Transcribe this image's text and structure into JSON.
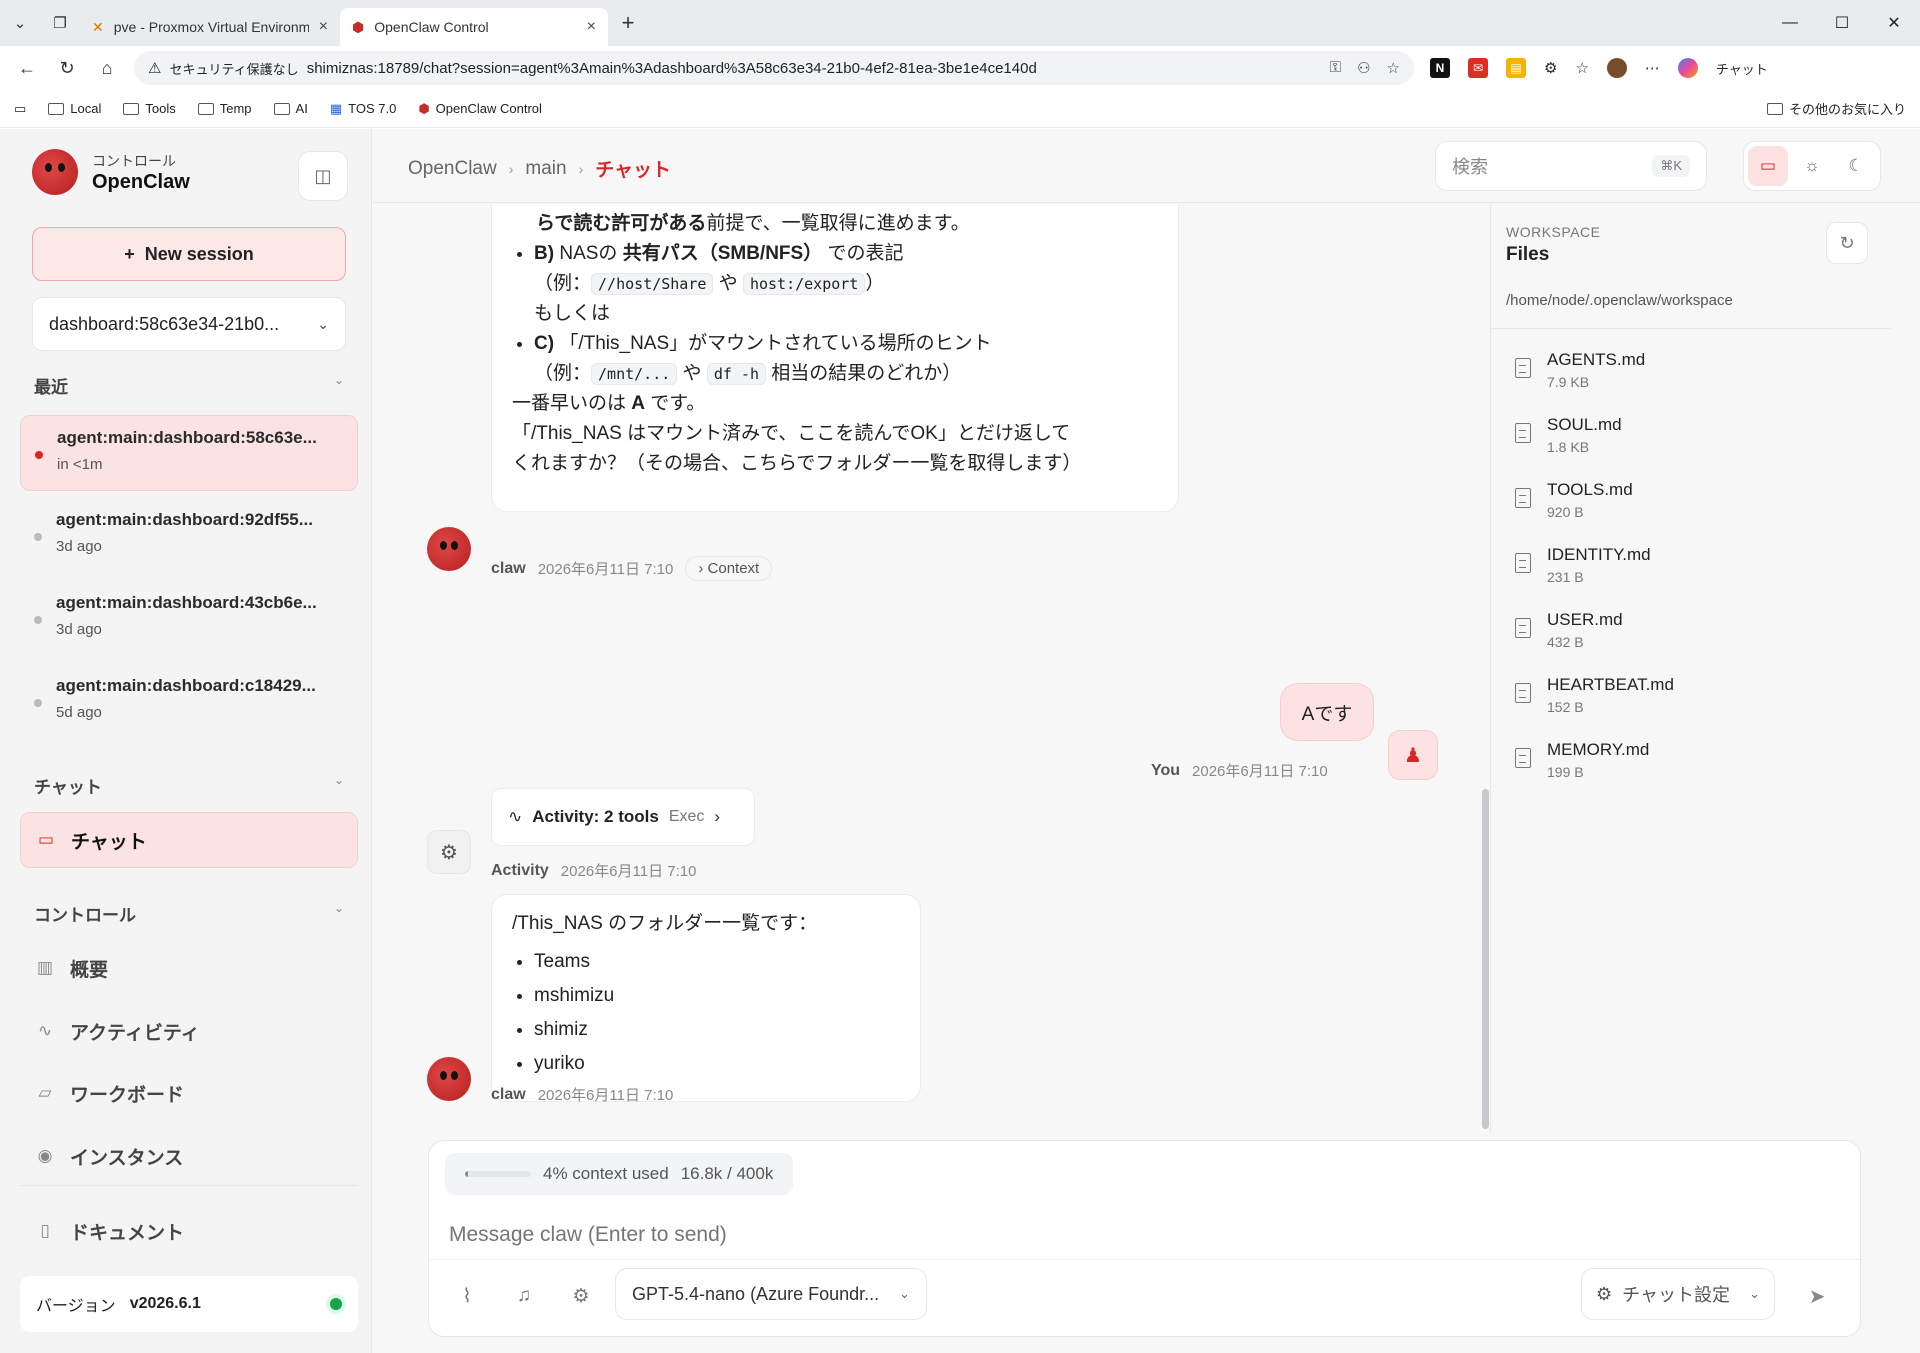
{
  "browser": {
    "tabs": [
      {
        "title": "pve - Proxmox Virtual Environment",
        "active": false
      },
      {
        "title": "OpenClaw Control",
        "active": true
      }
    ],
    "address": {
      "warning": "セキュリティ保護なし",
      "url": "shimiznas:18789/chat?session=agent%3Amain%3Adashboard%3A58c63e34-21b0-4ef2-81ea-3be1e4ce140d"
    },
    "copilot_label": "チャット",
    "bookmarks": [
      "Local",
      "Tools",
      "Temp",
      "AI",
      "TOS 7.0",
      "OpenClaw Control"
    ],
    "bookmarks_other": "その他のお気に入り"
  },
  "sidebar": {
    "brand_sub": "コントロール",
    "brand_title": "OpenClaw",
    "new_session": "New session",
    "session_select": "dashboard:58c63e34-21b0...",
    "recent_header": "最近",
    "sessions": [
      {
        "name": "agent:main:dashboard:58c63e...",
        "time": "in <1m"
      },
      {
        "name": "agent:main:dashboard:92df55...",
        "time": "3d ago"
      },
      {
        "name": "agent:main:dashboard:43cb6e...",
        "time": "3d ago"
      },
      {
        "name": "agent:main:dashboard:c18429...",
        "time": "5d ago"
      }
    ],
    "chat_header": "チャット",
    "chat_item": "チャット",
    "control_header": "コントロール",
    "control_items": [
      "概要",
      "アクティビティ",
      "ワークボード",
      "インスタンス"
    ],
    "docs": "ドキュメント",
    "version_label": "バージョン",
    "version_value": "v2026.6.1"
  },
  "header": {
    "crumbs": [
      "OpenClaw",
      "main",
      "チャット"
    ],
    "search_placeholder": "検索",
    "search_kbd": "⌘K"
  },
  "chat": {
    "msg1": {
      "partial_top": "らで読む許可がある",
      "partial_top_rest": "前提で、一覧取得に進めます。",
      "b_label": "B)",
      "b_text1": " NASの ",
      "b_bold": "共有パス（SMB/NFS）",
      "b_text2": " での表記",
      "b_ex_pre": "（例：",
      "b_code1": "//host/Share",
      "b_mid": " や ",
      "b_code2": "host:/export",
      "b_ex_post": "）",
      "b_or": "もしくは",
      "c_label": "C)",
      "c_text": " 「/This_NAS」がマウントされている場所のヒント",
      "c_ex_pre": "（例：",
      "c_code1": "/mnt/...",
      "c_mid": " や ",
      "c_code2": "df -h",
      "c_ex_post": " 相当の結果のどれか）",
      "fastest_pre": "一番早いのは ",
      "fastest_bold": "A",
      "fastest_post": " です。",
      "closing": "「/This_NAS はマウント済みで、ここを読んでOK」とだけ返してくれますか？（その場合、こちらでフォルダー一覧を取得します）",
      "who": "claw",
      "time": "2026年6月11日 7:10",
      "context": "Context"
    },
    "user_msg": {
      "text": "Aです",
      "who": "You",
      "time": "2026年6月11日 7:10"
    },
    "activity": {
      "title": "Activity: 2 tools",
      "tag": "Exec",
      "who": "Activity",
      "time": "2026年6月11日 7:10"
    },
    "msg2": {
      "intro": "/This_NAS のフォルダー一覧です：",
      "items": [
        "Teams",
        "mshimizu",
        "shimiz",
        "yuriko"
      ],
      "who": "claw",
      "time": "2026年6月11日 7:10"
    }
  },
  "workspace": {
    "label": "WORKSPACE",
    "title": "Files",
    "path": "/home/node/.openclaw/workspace",
    "files": [
      {
        "name": "AGENTS.md",
        "size": "7.9 KB"
      },
      {
        "name": "SOUL.md",
        "size": "1.8 KB"
      },
      {
        "name": "TOOLS.md",
        "size": "920 B"
      },
      {
        "name": "IDENTITY.md",
        "size": "231 B"
      },
      {
        "name": "USER.md",
        "size": "432 B"
      },
      {
        "name": "HEARTBEAT.md",
        "size": "152 B"
      },
      {
        "name": "MEMORY.md",
        "size": "199 B"
      }
    ]
  },
  "composer": {
    "context_pct": "4% context used",
    "context_fraction": 0.04,
    "context_tokens": "16.8k / 400k",
    "placeholder": "Message claw (Enter to send)",
    "model": "GPT-5.4-nano (Azure Foundr...",
    "chat_settings": "チャット設定"
  },
  "colors": {
    "accent": "#dc2626",
    "accent_bg": "#fde2e2",
    "status_ok": "#16a34a"
  }
}
